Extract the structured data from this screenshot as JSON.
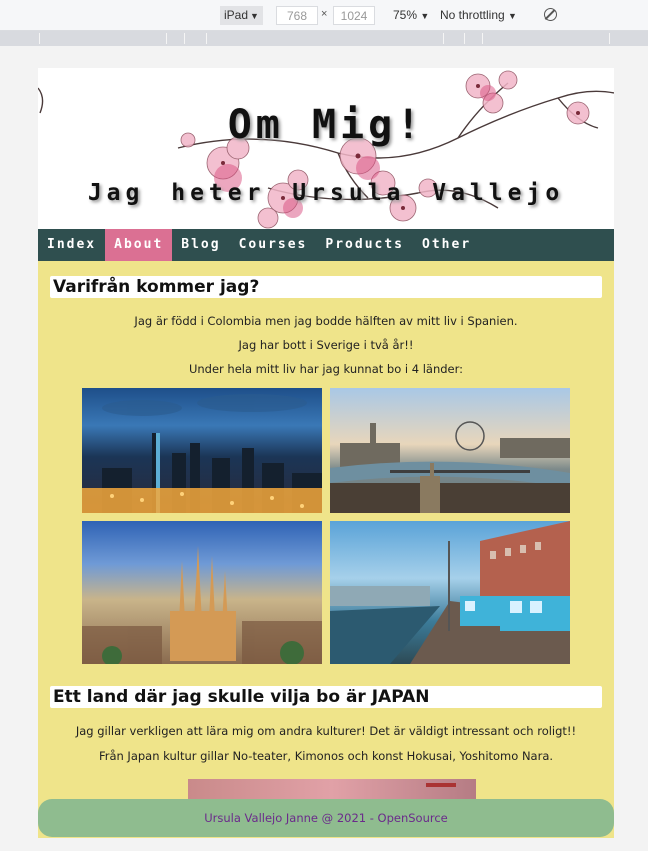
{
  "devtools": {
    "device": "iPad",
    "width": "768",
    "times": "×",
    "height": "1024",
    "zoom": "75%",
    "throttling": "No throttling"
  },
  "header": {
    "title": "Om Mig!",
    "subtitle": "Jag heter Ursula Vallejo"
  },
  "nav": {
    "items": [
      {
        "label": "Index"
      },
      {
        "label": "About"
      },
      {
        "label": "Blog"
      },
      {
        "label": "Courses"
      },
      {
        "label": "Products"
      },
      {
        "label": "Other"
      }
    ],
    "active": "About"
  },
  "section1": {
    "heading": "Varifrån kommer jag?",
    "paragraphs": [
      "Jag är född i Colombia men jag bodde hälften av mitt liv i Spanien.",
      "Jag har bott i Sverige i två år!!",
      "Under hela mitt liv har jag kunnat bo i 4 länder:"
    ]
  },
  "section2": {
    "heading": "Ett land där jag skulle vilja bo är JAPAN",
    "paragraphs": [
      "Jag gillar verkligen att lära mig om andra kulturer! Det är väldigt intressant och roligt!!",
      "Från Japan kultur gillar No-teater, Kimonos och konst Hokusai, Yoshitomo Nara."
    ]
  },
  "footer": {
    "text": "Ursula Vallejo Janne @ 2021 - OpenSource"
  },
  "colors": {
    "nav_bg": "#2f4f4f",
    "nav_active": "#db7093",
    "content_bg": "#efe48a",
    "footer_bg": "#8fbc8f",
    "footer_text": "#6b2a8b"
  }
}
